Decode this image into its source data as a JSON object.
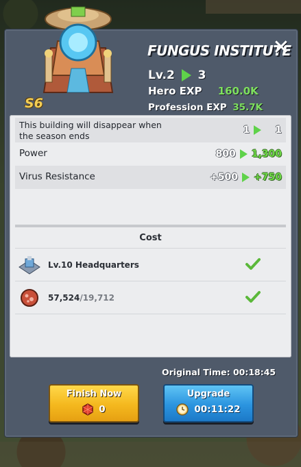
{
  "building": {
    "name": "FUNGUS INSTITUTE",
    "season_badge": "S6",
    "level_prefix": "Lv.2",
    "level_next": "3",
    "hero_exp_label": "Hero EXP",
    "hero_exp_value": "160.0K",
    "profession_exp_label": "Profession EXP",
    "profession_exp_value": "35.7K"
  },
  "attributes": [
    {
      "label": "This building will disappear when the season ends",
      "from": "1",
      "to": "1"
    },
    {
      "label": "Power",
      "from": "800",
      "to": "1,300"
    },
    {
      "label": "Virus Resistance",
      "from": "+500",
      "to": "+750"
    }
  ],
  "cost": {
    "header": "Cost",
    "items": [
      {
        "name": "Lv.10 Headquarters",
        "icon": "headquarters-icon"
      },
      {
        "owned": "57,524",
        "separator": "/",
        "required": "19,712",
        "icon": "virus-resource-icon"
      }
    ]
  },
  "timing": {
    "original_label": "Original Time: 00:18:45"
  },
  "buttons": {
    "finish_label": "Finish Now",
    "finish_cost": "0",
    "upgrade_label": "Upgrade",
    "upgrade_time": "00:11:22"
  },
  "colors": {
    "accent_green": "#7ee05e",
    "finish_button": "#f4b81e",
    "upgrade_button": "#2b94df",
    "panel": "#4f5a6a"
  }
}
